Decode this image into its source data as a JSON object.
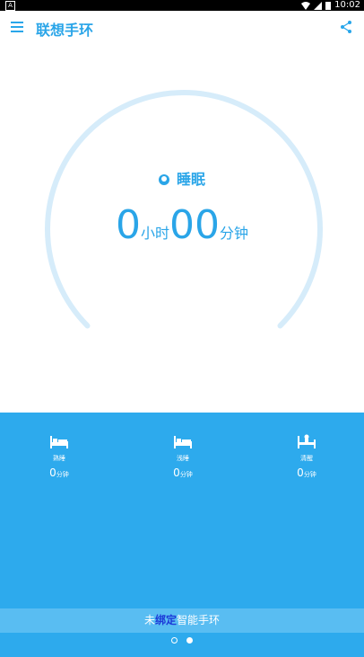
{
  "status_bar": {
    "time": "10:02"
  },
  "app_bar": {
    "title": "联想手环",
    "menu_icon": "menu-icon",
    "share_icon": "share-icon"
  },
  "gauge": {
    "label": "睡眠",
    "hours": "0",
    "hours_unit": "小时",
    "minutes": "00",
    "minutes_unit": "分钟",
    "progress": 0,
    "track_color": "#d6ecfa"
  },
  "stats": [
    {
      "label": "熟睡",
      "value": "0",
      "unit": "分钟",
      "icon": "bed-icon"
    },
    {
      "label": "浅睡",
      "value": "0",
      "unit": "分钟",
      "icon": "bed-icon"
    },
    {
      "label": "清醒",
      "value": "0",
      "unit": "分钟",
      "icon": "awake-icon"
    }
  ],
  "bind_banner": {
    "prefix": "未",
    "highlight": "绑定",
    "suffix": "智能手环"
  },
  "pager": {
    "pages": 2,
    "current": 2
  },
  "colors": {
    "accent": "#2aa5e8",
    "panel": "#2daaed",
    "banner": "#59bdf2",
    "highlight": "#1d3bd8"
  }
}
